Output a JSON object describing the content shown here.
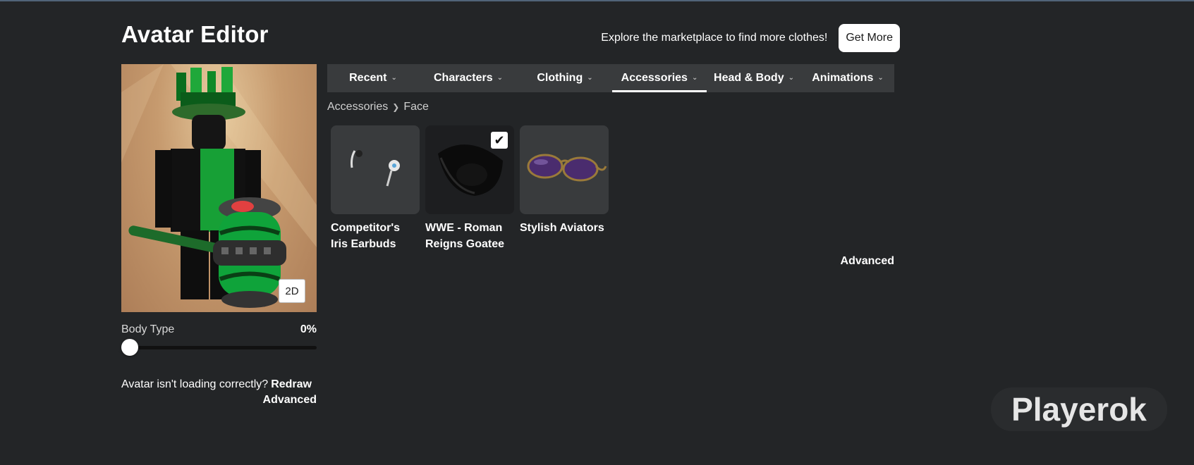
{
  "header": {
    "title": "Avatar Editor",
    "promo_text": "Explore the marketplace to find more clothes!",
    "get_more_label": "Get More"
  },
  "avatar": {
    "view_toggle_label": "2D",
    "body_type_label": "Body Type",
    "body_type_value": "0%",
    "loading_prompt": "Avatar isn't loading correctly?",
    "redraw_label": "Redraw",
    "advanced_label": "Advanced"
  },
  "tabs": [
    {
      "label": "Recent"
    },
    {
      "label": "Characters"
    },
    {
      "label": "Clothing"
    },
    {
      "label": "Accessories",
      "active": true
    },
    {
      "label": "Head & Body"
    },
    {
      "label": "Animations"
    }
  ],
  "breadcrumb": {
    "parent": "Accessories",
    "current": "Face"
  },
  "items": [
    {
      "name": "Competitor's Iris Earbuds",
      "selected": false,
      "icon": "earbuds-icon"
    },
    {
      "name": "WWE - Roman Reigns Goatee",
      "selected": true,
      "icon": "goatee-icon"
    },
    {
      "name": "Stylish Aviators",
      "selected": false,
      "icon": "aviators-icon"
    }
  ],
  "advanced_label": "Advanced",
  "watermark": "Playerok",
  "colors": {
    "background": "#232527",
    "tab_bar": "#393b3d",
    "item_tile": "#393b3d",
    "accent": "#ffffff"
  }
}
